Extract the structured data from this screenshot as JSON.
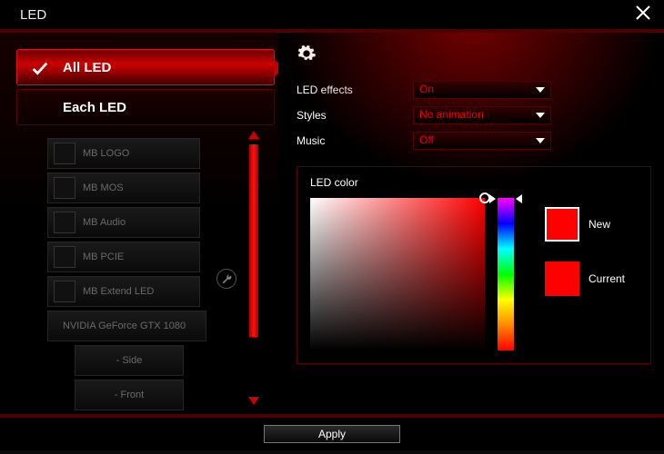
{
  "window": {
    "title": "LED"
  },
  "tabs": {
    "all": {
      "label": "All LED",
      "active": true
    },
    "each": {
      "label": "Each LED",
      "active": false
    }
  },
  "devices": [
    {
      "name": "MB LOGO"
    },
    {
      "name": "MB MOS"
    },
    {
      "name": "MB Audio"
    },
    {
      "name": "MB PCIE"
    },
    {
      "name": "MB Extend LED"
    },
    {
      "name": "NVIDIA GeForce GTX 1080",
      "gpu": true
    },
    {
      "name": "- Side",
      "sub": true
    },
    {
      "name": "- Front",
      "sub": true
    }
  ],
  "settings": {
    "led_effects": {
      "label": "LED effects",
      "value": "On"
    },
    "styles": {
      "label": "Styles",
      "value": "No animation"
    },
    "music": {
      "label": "Music",
      "value": "Off"
    }
  },
  "colorbox": {
    "title": "LED color",
    "new_label": "New",
    "current_label": "Current",
    "new_color": "#ff0000",
    "current_color": "#ff0000"
  },
  "footer": {
    "apply": "Apply"
  }
}
